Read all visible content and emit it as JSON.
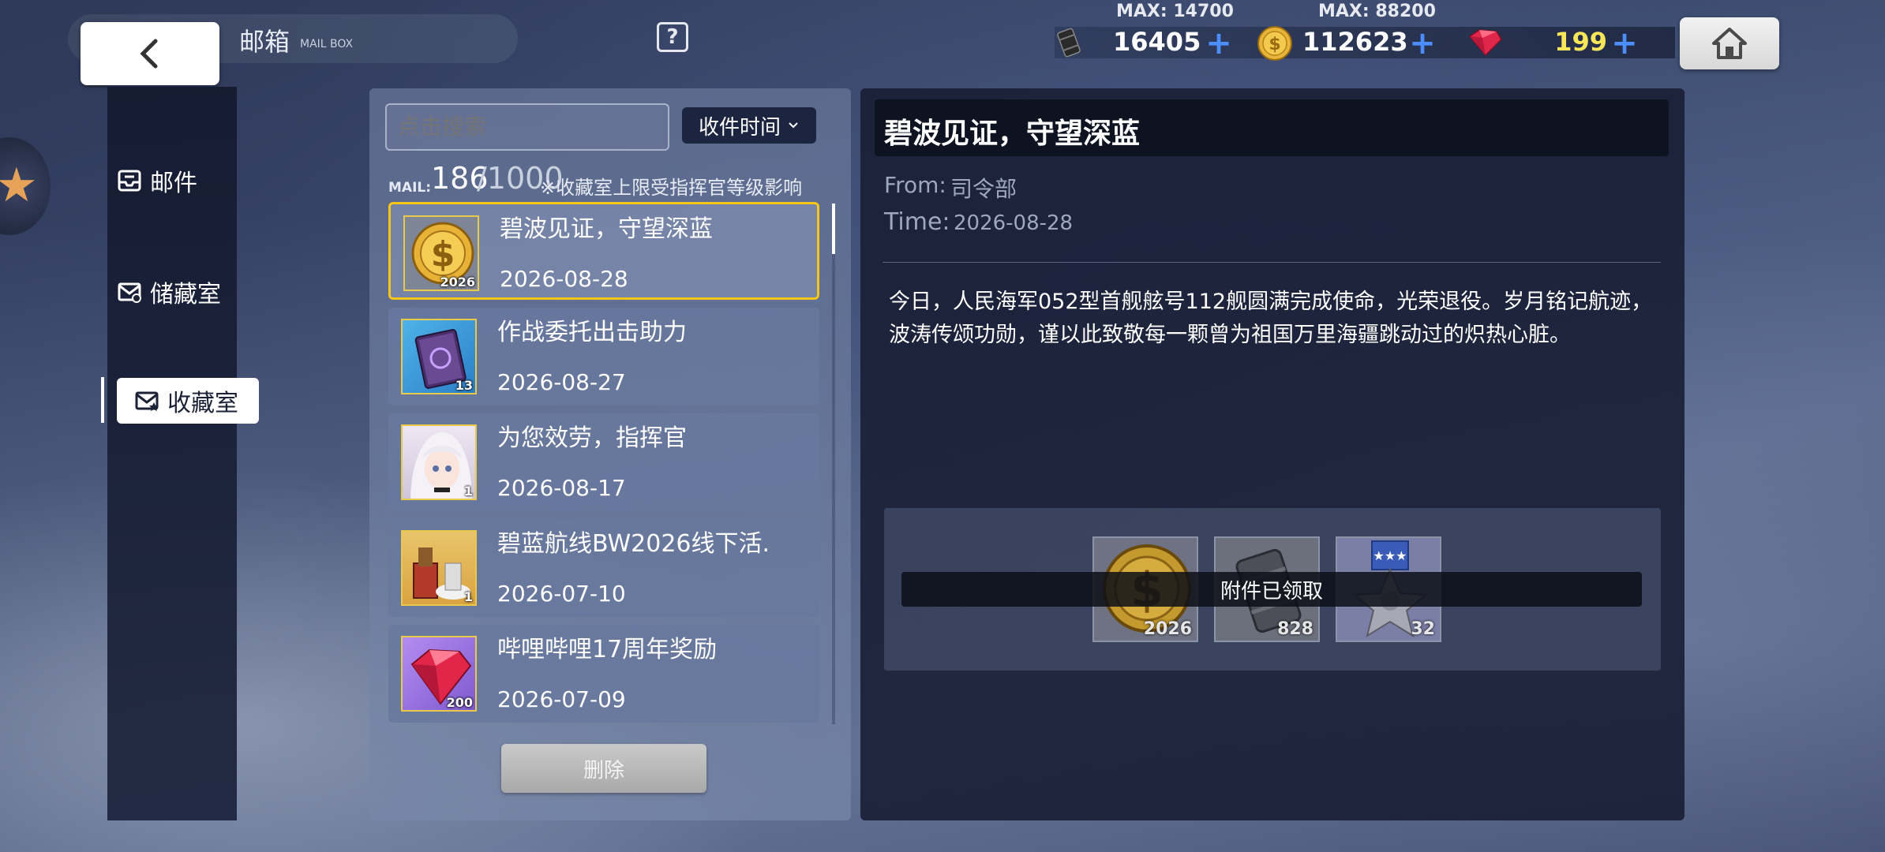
{
  "header": {
    "title": "邮箱",
    "subtitle": "MAIL BOX",
    "help_label": "?"
  },
  "resources": [
    {
      "name": "oil",
      "icon": "oil-barrel-icon",
      "max_label": "MAX: 14700",
      "value": "16405",
      "color": "#ffffff"
    },
    {
      "name": "coins",
      "icon": "gold-coin-icon",
      "max_label": "MAX: 88200",
      "value": "112623",
      "color": "#ffffff"
    },
    {
      "name": "gems",
      "icon": "ruby-gem-icon",
      "max_label": "",
      "value": "199",
      "color": "#f7e55a"
    }
  ],
  "sidebar": {
    "items": [
      {
        "label": "邮件",
        "icon": "mail-inbox-icon"
      },
      {
        "label": "储藏室",
        "icon": "mail-storage-icon"
      },
      {
        "label": "收藏室",
        "icon": "mail-favorite-icon",
        "active": true
      }
    ]
  },
  "list": {
    "search_placeholder": "点击搜索",
    "sort_label": "收件时间",
    "mail_label": "MAIL:",
    "mail_count": "186",
    "mail_max": "/1000",
    "mail_note": "※收藏室上限受指挥官等级影响",
    "items": [
      {
        "title": "碧波见证，守望深蓝",
        "date": "2026-08-28",
        "qty": "2026",
        "thumb": "gold-coin-icon"
      },
      {
        "title": "作战委托出击助力",
        "date": "2026-08-27",
        "qty": "13",
        "thumb": "book-icon"
      },
      {
        "title": "为您效劳，指挥官",
        "date": "2026-08-17",
        "qty": "1",
        "thumb": "character-portrait-icon"
      },
      {
        "title": "碧蓝航线BW2026线下活.",
        "date": "2026-07-10",
        "qty": "1",
        "thumb": "furniture-icon"
      },
      {
        "title": "哔哩哔哩17周年奖励",
        "date": "2026-07-09",
        "qty": "200",
        "thumb": "ruby-gem-icon"
      }
    ],
    "delete_label": "删除"
  },
  "detail": {
    "title": "碧波见证，守望深蓝",
    "from_label": "From:",
    "from": "司令部",
    "time_label": "Time:",
    "time": "2026-08-28",
    "body": "今日，人民海军052型首舰舷号112舰圆满完成使命，光荣退役。岁月铭记航迹，波涛传颂功勋，谨以此致敬每一颗曾为祖国万里海疆跳动过的炽热心脏。",
    "attachments": [
      {
        "icon": "gold-coin-icon",
        "qty": "2026"
      },
      {
        "icon": "oil-barrel-icon",
        "qty": "828"
      },
      {
        "icon": "medal-icon",
        "qty": "32"
      }
    ],
    "claimed_label": "附件已领取"
  }
}
